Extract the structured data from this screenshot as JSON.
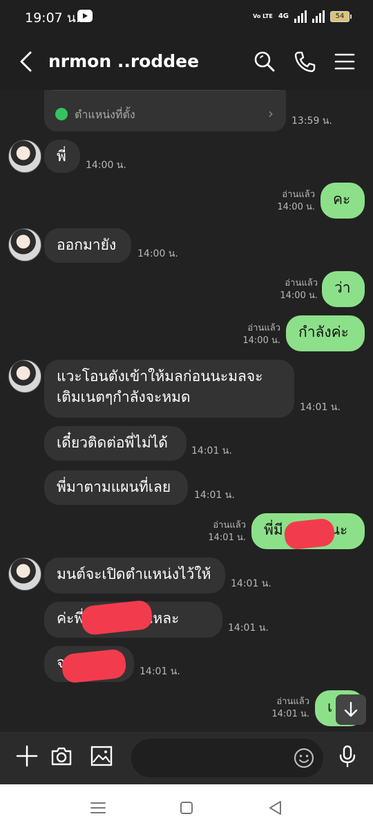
{
  "status": {
    "time": "19:07 น.",
    "network": "4G",
    "volte": "Vo LTE",
    "battery": "54"
  },
  "header": {
    "title": "nrmon ..roddee"
  },
  "messages": {
    "location": {
      "label": "ตำแหน่งที่ตั้ง",
      "time": "13:59 น."
    },
    "m1": {
      "text": "พี่",
      "time": "14:00 น."
    },
    "m2": {
      "text": "คะ",
      "read": "อ่านแล้ว",
      "time": "14:00 น."
    },
    "m3": {
      "text": "ออกมายัง",
      "time": "14:00 น."
    },
    "m4": {
      "text": "ว่า",
      "read": "อ่านแล้ว",
      "time": "14:00 น."
    },
    "m5": {
      "text": "กำลังค่ะ",
      "read": "อ่านแล้ว",
      "time": "14:00 น."
    },
    "m6": {
      "line1": "แวะโอนตังเข้าให้มลก่อนนะมลจะ",
      "line2": "เติมเนตๆกำลังจะหมด",
      "time": "14:01 น."
    },
    "m7": {
      "text": "เดี๋ยวติดต่อพี่ไม่ได้",
      "time": "14:01 น."
    },
    "m8": {
      "text": "พี่มาตามแผนที่เลย",
      "time": "14:01 น."
    },
    "m9": {
      "text_start": "พี่มี",
      "text_end": "วนะ",
      "read": "อ่านแล้ว",
      "time": "14:01 น."
    },
    "m10": {
      "text": "มนต์จะเปิดตำแหน่งไว้ให้",
      "time": "14:01 น."
    },
    "m11": {
      "text_start": "ค่ะพี่",
      "text_end": "นั่นแหละ",
      "time": "14:01 น."
    },
    "m12": {
      "text_start": "จ",
      "time": "14:01 น."
    },
    "m13": {
      "text_start": "เ",
      "read": "อ่านแล้ว",
      "time": "14:01 น."
    }
  },
  "icons": {
    "back": "back-arrow-icon",
    "search": "search-icon",
    "call": "phone-icon",
    "menu": "hamburger-icon",
    "add": "plus-icon",
    "camera": "camera-icon",
    "image": "image-icon",
    "emoji": "emoji-icon",
    "mic": "microphone-icon"
  },
  "colors": {
    "outgoing_bubble": "#8de08a",
    "incoming_bubble": "#333333",
    "background": "#222222",
    "redaction": "#f23c4d"
  }
}
